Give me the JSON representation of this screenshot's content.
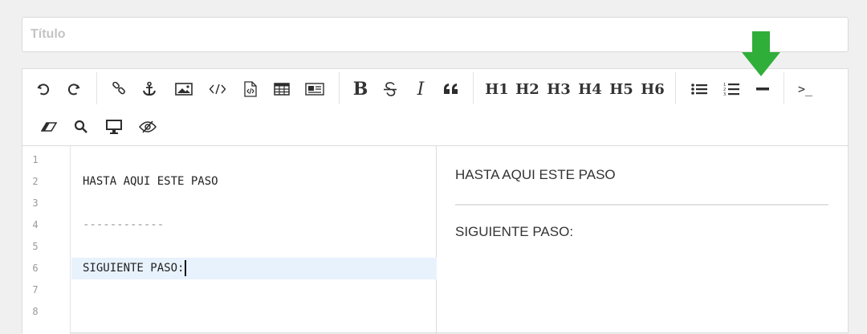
{
  "title_field": {
    "placeholder": "Título",
    "value": ""
  },
  "toolbar": {
    "undo_icon": "undo-icon",
    "redo_icon": "redo-icon",
    "headings": [
      "H1",
      "H2",
      "H3",
      "H4",
      "H5",
      "H6"
    ],
    "bold_label": "B",
    "italic_label": "I",
    "terminal_label": ">_"
  },
  "editor": {
    "line_numbers": [
      "1",
      "2",
      "3",
      "4",
      "5",
      "6",
      "7",
      "8"
    ],
    "lines": [
      "",
      "HASTA AQUI ESTE PASO",
      "",
      "------------",
      "",
      "SIGUIENTE PASO:",
      "",
      ""
    ],
    "active_line": 6
  },
  "preview": {
    "paragraph_1": "HASTA AQUI ESTE PASO",
    "paragraph_2": "SIGUIENTE PASO:"
  },
  "colors": {
    "arrow": "#2fae3a",
    "active_line_bg": "#e8f2fd"
  }
}
